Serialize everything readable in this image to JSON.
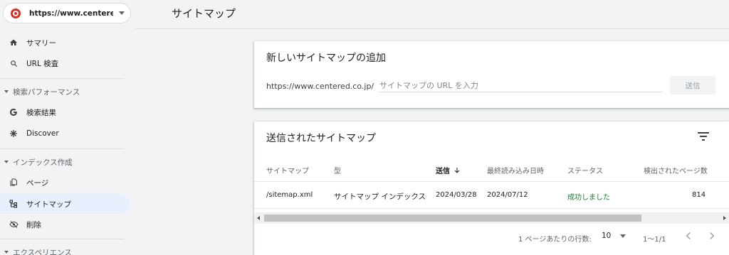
{
  "property": {
    "url": "https://www.centere..."
  },
  "nav": {
    "summary": "サマリー",
    "url_inspection": "URL 検査",
    "section_performance": "検索パフォーマンス",
    "search_results": "検索結果",
    "discover": "Discover",
    "section_index": "インデックス作成",
    "pages": "ページ",
    "sitemaps": "サイトマップ",
    "removals": "削除",
    "section_experience": "エクスペリエンス"
  },
  "page_title": "サイトマップ",
  "add_card": {
    "title": "新しいサイトマップの追加",
    "url_prefix": "https://www.centered.co.jp/",
    "input_placeholder": "サイトマップの URL を入力",
    "input_value": "",
    "submit_label": "送信"
  },
  "submitted_card": {
    "title": "送信されたサイトマップ",
    "filter_icon": "filter-list-icon",
    "columns": {
      "sitemap": "サイトマップ",
      "type": "型",
      "submitted": "送信",
      "last_read": "最終読み込み日時",
      "status": "ステータス",
      "discovered_pages": "検出されたページ数"
    },
    "sort_icon": "arrow-downward-icon",
    "rows": [
      {
        "sitemap": "/sitemap.xml",
        "type": "サイトマップ インデックス",
        "submitted": "2024/03/28",
        "last_read": "2024/07/12",
        "status": "成功しました",
        "discovered_pages": "814"
      }
    ],
    "pagination": {
      "rows_per_page_label": "1 ページあたりの行数:",
      "rows_per_page": "10",
      "range": "1〜1/1"
    }
  },
  "colors": {
    "background": "#f1f3f4",
    "active_nav": "#e8f0fe",
    "success": "#188038",
    "favicon": "#d93025"
  }
}
